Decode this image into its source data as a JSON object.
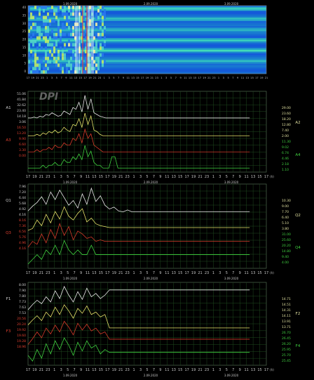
{
  "colors": {
    "background": "#000000",
    "grid": "#1f4a1f",
    "frame": "#4f6a4f",
    "axis_text": "#c8c8c8",
    "series_white": "#e8e8e8",
    "series_yellow": "#e6e26a",
    "series_red": "#d43a2a",
    "series_green": "#3fcf3f",
    "label_left_upper": "#d0d0d0",
    "label_left_lower": "#e04030",
    "label_right_upper": "#e0e0a0",
    "label_right_lower": "#40d040"
  },
  "logo_text": "DPI",
  "spectrogram": {
    "date_labels": [
      "1.09.2020",
      "2.09.2020",
      "3.09.2020"
    ],
    "y_ticks": [
      "40",
      "35",
      "30",
      "25",
      "20",
      "15",
      "10",
      "5",
      "0"
    ],
    "x_ticks": [
      "17",
      "19",
      "21",
      "23",
      "1",
      "3",
      "5",
      "7",
      "9",
      "11",
      "13",
      "15",
      "17",
      "19",
      "21",
      "23",
      "1",
      "3",
      "5",
      "7",
      "9",
      "11",
      "13",
      "15",
      "17",
      "19",
      "21",
      "23",
      "1",
      "3",
      "5",
      "7",
      "9",
      "11",
      "13",
      "15",
      "17",
      "19",
      "21",
      "23",
      "1",
      "3",
      "5",
      "7",
      "9",
      "11",
      "13",
      "15",
      "17",
      "19",
      "21"
    ]
  },
  "x_axis": {
    "hour_ticks": [
      "17",
      "19",
      "21",
      "23",
      "1",
      "3",
      "5",
      "7",
      "9",
      "11",
      "13",
      "15",
      "17",
      "19",
      "21",
      "23",
      "1",
      "3",
      "5",
      "7",
      "9",
      "11",
      "13",
      "15",
      "17",
      "19",
      "21",
      "23",
      "1",
      "3",
      "5",
      "7",
      "9",
      "11",
      "13",
      "15",
      "17"
    ],
    "date_labels": [
      "1.09.2020",
      "2.09.2020",
      "3.09.2020"
    ],
    "unit": "(h)"
  },
  "panels": [
    {
      "id": "A",
      "label_left_upper": "A1",
      "label_left_lower": "A3",
      "label_right_upper": "A2",
      "label_right_lower": "A4",
      "left_ticks_upper": [
        "51.06",
        "41.84",
        "32.62",
        "23.40",
        "14.18",
        "3.06"
      ],
      "left_ticks_lower": [
        "16.50",
        "13.20",
        "9.90",
        "6.60",
        "3.30",
        "0.00"
      ],
      "right_ticks_upper": [
        "29.00",
        "23.60",
        "18.20",
        "12.80",
        "7.40",
        "2.00"
      ],
      "right_ticks_lower": [
        "11.30",
        "9.02",
        "6.74",
        "4.46",
        "2.18",
        "1.10"
      ]
    },
    {
      "id": "Q",
      "label_left_upper": "Q1",
      "label_left_lower": "Q3",
      "label_right_upper": "Q2",
      "label_right_lower": "Q4",
      "left_ticks_upper": [
        "7.96",
        "7.20",
        "6.44",
        "5.68",
        "4.92",
        "4.16"
      ],
      "left_ticks_lower": [
        "8.16",
        "7.36",
        "6.56",
        "5.76",
        "4.96",
        "4.16"
      ],
      "right_ticks_upper": [
        "10.30",
        "9.00",
        "7.70",
        "6.40",
        "5.10",
        "3.80"
      ],
      "right_ticks_lower": [
        "31.00",
        "25.60",
        "20.20",
        "14.80",
        "9.40",
        "4.00"
      ]
    },
    {
      "id": "F",
      "label_left_upper": "F1",
      "label_left_lower": "F3",
      "label_right_upper": "F2",
      "label_right_lower": "F4",
      "left_ticks_upper": [
        "8.00",
        "7.90",
        "7.80",
        "7.73",
        "7.63",
        "7.53"
      ],
      "left_ticks_lower": [
        "20.56",
        "20.24",
        "19.92",
        "19.60",
        "19.28",
        "18.96"
      ],
      "right_ticks_upper": [
        "14.71",
        "14.51",
        "14.31",
        "14.11",
        "13.91",
        "13.71"
      ],
      "right_ticks_lower": [
        "26.70",
        "26.45",
        "26.20",
        "25.95",
        "25.70",
        "25.45"
      ]
    }
  ],
  "chart_data": [
    {
      "type": "heatmap",
      "title": "",
      "xlabel": "(h)",
      "ylabel": "",
      "ylim": [
        0,
        40
      ],
      "x_start_hour": 17,
      "x_end_hour": 21,
      "note_values": "intensity grid (rows low->high frequency), data span ends near 23h on 1.09.2020",
      "bands": [
        7.8,
        14.1,
        20.3,
        26.4,
        32.5,
        38.6
      ]
    },
    {
      "type": "line",
      "title": "",
      "series": [
        {
          "name": "A1",
          "values": [
            2,
            2,
            3,
            2,
            4,
            3,
            6,
            5,
            8,
            6,
            4,
            5,
            10,
            8,
            6,
            14,
            12,
            20,
            9,
            28,
            12,
            24,
            8,
            6,
            4,
            3,
            2,
            2,
            2,
            2,
            2,
            2,
            2,
            2,
            2,
            2,
            2,
            2,
            2,
            2,
            2,
            2,
            2,
            2,
            2,
            2,
            2,
            2,
            2,
            2,
            2,
            2,
            2,
            2,
            2,
            2,
            2,
            2,
            2,
            2,
            2,
            2,
            2,
            2,
            2,
            2,
            2,
            2,
            2,
            2,
            2,
            2,
            2,
            2,
            2
          ]
        },
        {
          "name": "A2",
          "values": [
            2,
            2,
            2,
            3,
            2,
            4,
            3,
            5,
            4,
            6,
            4,
            5,
            8,
            6,
            5,
            10,
            9,
            14,
            8,
            18,
            10,
            16,
            6,
            5,
            3,
            2,
            2,
            2,
            2,
            2,
            2,
            2,
            2,
            2,
            2,
            2,
            2,
            2,
            2,
            2,
            2,
            2,
            2,
            2,
            2,
            2,
            2,
            2,
            2,
            2,
            2,
            2,
            2,
            2,
            2,
            2,
            2,
            2,
            2,
            2,
            2,
            2,
            2,
            2,
            2,
            2,
            2,
            2,
            2,
            2,
            2,
            2,
            2,
            2,
            2
          ]
        },
        {
          "name": "A3",
          "values": [
            1,
            1,
            1,
            2,
            1,
            2,
            2,
            3,
            2,
            4,
            3,
            3,
            5,
            4,
            4,
            7,
            6,
            9,
            5,
            11,
            7,
            9,
            4,
            3,
            2,
            1,
            1,
            1,
            1,
            1,
            1,
            1,
            1,
            1,
            1,
            1,
            1,
            1,
            1,
            1,
            1,
            1,
            1,
            1,
            1,
            1,
            1,
            1,
            1,
            1,
            1,
            1,
            1,
            1,
            1,
            1,
            1,
            1,
            1,
            1,
            1,
            1,
            1,
            1,
            1,
            1,
            1,
            1,
            1,
            1,
            1,
            1,
            1,
            1,
            1
          ]
        },
        {
          "name": "A4",
          "values": [
            1,
            1,
            1,
            1,
            1,
            2,
            1,
            2,
            2,
            3,
            2,
            2,
            4,
            3,
            3,
            5,
            4,
            6,
            4,
            9,
            5,
            7,
            3,
            2,
            2,
            1,
            1,
            1,
            5,
            5,
            1,
            1,
            1,
            1,
            1,
            1,
            1,
            1,
            1,
            1,
            1,
            1,
            1,
            1,
            1,
            1,
            1,
            1,
            1,
            1,
            1,
            1,
            1,
            1,
            1,
            1,
            1,
            1,
            1,
            1,
            1,
            1,
            1,
            1,
            1,
            1,
            1,
            1,
            1,
            1,
            1,
            1,
            1,
            1,
            1
          ]
        }
      ]
    },
    {
      "type": "line",
      "title": "",
      "series": [
        {
          "name": "Q1",
          "values": [
            5.4,
            5.9,
            6.3,
            6.9,
            6.1,
            7.4,
            6.6,
            7.6,
            6.8,
            6.0,
            6.5,
            5.7,
            7.2,
            6.1,
            7.8,
            6.4,
            7.0,
            6.0,
            5.6,
            5.8,
            5.4,
            5.3,
            5.5,
            5.3,
            5.3,
            5.3,
            5.3,
            5.3,
            5.3,
            5.3,
            5.3,
            5.3,
            5.3,
            5.3,
            5.3,
            5.3,
            5.3,
            5.3,
            5.3,
            5.3,
            5.3,
            5.3,
            5.3,
            5.3,
            5.3,
            5.3,
            5.3,
            5.3,
            5.3,
            5.3
          ]
        },
        {
          "name": "Q2",
          "values": [
            5.1,
            5.3,
            6.2,
            5.6,
            6.8,
            5.9,
            7.1,
            6.3,
            7.6,
            6.6,
            6.2,
            6.9,
            7.4,
            6.0,
            6.4,
            5.8,
            5.6,
            5.5,
            5.4,
            5.4,
            5.4,
            5.4,
            5.4,
            5.4,
            5.4,
            5.4,
            5.4,
            5.4,
            5.4,
            5.4,
            5.4,
            5.4,
            5.4,
            5.4,
            5.4,
            5.4,
            5.4,
            5.4,
            5.4,
            5.4,
            5.4,
            5.4,
            5.4,
            5.4,
            5.4,
            5.4,
            5.4,
            5.4,
            5.4,
            5.4
          ]
        },
        {
          "name": "Q3",
          "values": [
            5.0,
            5.4,
            5.2,
            5.9,
            5.3,
            6.2,
            5.6,
            6.6,
            5.8,
            6.4,
            5.5,
            6.1,
            5.9,
            5.6,
            5.7,
            5.4,
            5.5,
            5.4,
            5.4,
            5.4,
            5.4,
            5.4,
            5.4,
            5.4,
            5.4,
            5.4,
            5.4,
            5.4,
            5.4,
            5.4,
            5.4,
            5.4,
            5.4,
            5.4,
            5.4,
            5.4,
            5.4,
            5.4,
            5.4,
            5.4,
            5.4,
            5.4,
            5.4,
            5.4,
            5.4,
            5.4,
            5.4,
            5.4,
            5.4,
            5.4
          ]
        },
        {
          "name": "Q4",
          "values": [
            4.4,
            4.5,
            4.6,
            4.5,
            4.7,
            4.6,
            4.8,
            4.6,
            4.9,
            4.7,
            4.6,
            4.7,
            4.6,
            4.6,
            4.8,
            4.6,
            4.6,
            4.6,
            4.6,
            4.6,
            4.6,
            4.6,
            4.6,
            4.6,
            4.6,
            4.6,
            4.6,
            4.6,
            4.6,
            4.6,
            4.6,
            4.6,
            4.6,
            4.6,
            4.6,
            4.6,
            4.6,
            4.6,
            4.6,
            4.6,
            4.6,
            4.6,
            4.6,
            4.6,
            4.6,
            4.6,
            4.6,
            4.6,
            4.6,
            4.6
          ]
        }
      ]
    },
    {
      "type": "line",
      "title": "",
      "series": [
        {
          "name": "F1",
          "values": [
            7.63,
            7.69,
            7.74,
            7.7,
            7.78,
            7.72,
            7.85,
            7.76,
            7.9,
            7.8,
            7.72,
            7.84,
            7.75,
            7.88,
            7.78,
            7.82,
            7.76,
            7.8,
            7.86,
            7.86,
            7.86,
            7.86,
            7.86,
            7.86,
            7.86,
            7.86,
            7.86,
            7.86,
            7.86,
            7.86,
            7.86,
            7.86,
            7.86,
            7.86,
            7.86,
            7.86,
            7.86,
            7.86,
            7.86,
            7.86,
            7.86,
            7.86,
            7.86,
            7.86,
            7.86,
            7.86,
            7.86,
            7.86,
            7.86,
            7.86
          ]
        },
        {
          "name": "F2",
          "values": [
            14.01,
            14.09,
            14.16,
            14.08,
            14.22,
            14.14,
            14.3,
            14.18,
            14.34,
            14.24,
            14.12,
            14.28,
            14.2,
            14.32,
            14.18,
            14.22,
            14.14,
            14.18,
            13.96,
            13.96,
            13.96,
            13.96,
            13.96,
            13.96,
            13.96,
            13.96,
            13.96,
            13.96,
            13.96,
            13.96,
            13.96,
            13.96,
            13.96,
            13.96,
            13.96,
            13.96,
            13.96,
            13.96,
            13.96,
            13.96,
            13.96,
            13.96,
            13.96,
            13.96,
            13.96,
            13.96,
            13.96,
            13.96,
            13.96,
            13.96
          ]
        },
        {
          "name": "F3",
          "values": [
            19.44,
            19.56,
            19.7,
            19.58,
            19.78,
            19.66,
            19.84,
            19.7,
            19.92,
            19.8,
            19.64,
            19.88,
            19.74,
            19.86,
            19.72,
            19.78,
            19.66,
            19.7,
            19.55,
            19.55,
            19.55,
            19.55,
            19.55,
            19.55,
            19.55,
            19.55,
            19.55,
            19.55,
            19.55,
            19.55,
            19.55,
            19.55,
            19.55,
            19.55,
            19.55,
            19.55,
            19.55,
            19.55,
            19.55,
            19.55,
            19.55,
            19.55,
            19.55,
            19.55,
            19.55,
            19.55,
            19.55,
            19.55,
            19.55,
            19.55
          ]
        },
        {
          "name": "F4",
          "values": [
            25.7,
            25.62,
            25.78,
            25.66,
            25.86,
            25.72,
            25.9,
            25.78,
            25.94,
            25.84,
            25.7,
            25.88,
            25.76,
            25.9,
            25.8,
            25.84,
            25.72,
            25.78,
            25.74,
            25.74,
            25.74,
            25.74,
            25.74,
            25.74,
            25.74,
            25.74,
            25.74,
            25.74,
            25.74,
            25.74,
            25.74,
            25.74,
            25.74,
            25.74,
            25.74,
            25.74,
            25.74,
            25.74,
            25.74,
            25.74,
            25.74,
            25.74,
            25.74,
            25.74,
            25.74,
            25.74,
            25.74,
            25.74,
            25.74,
            25.74
          ]
        }
      ]
    }
  ]
}
